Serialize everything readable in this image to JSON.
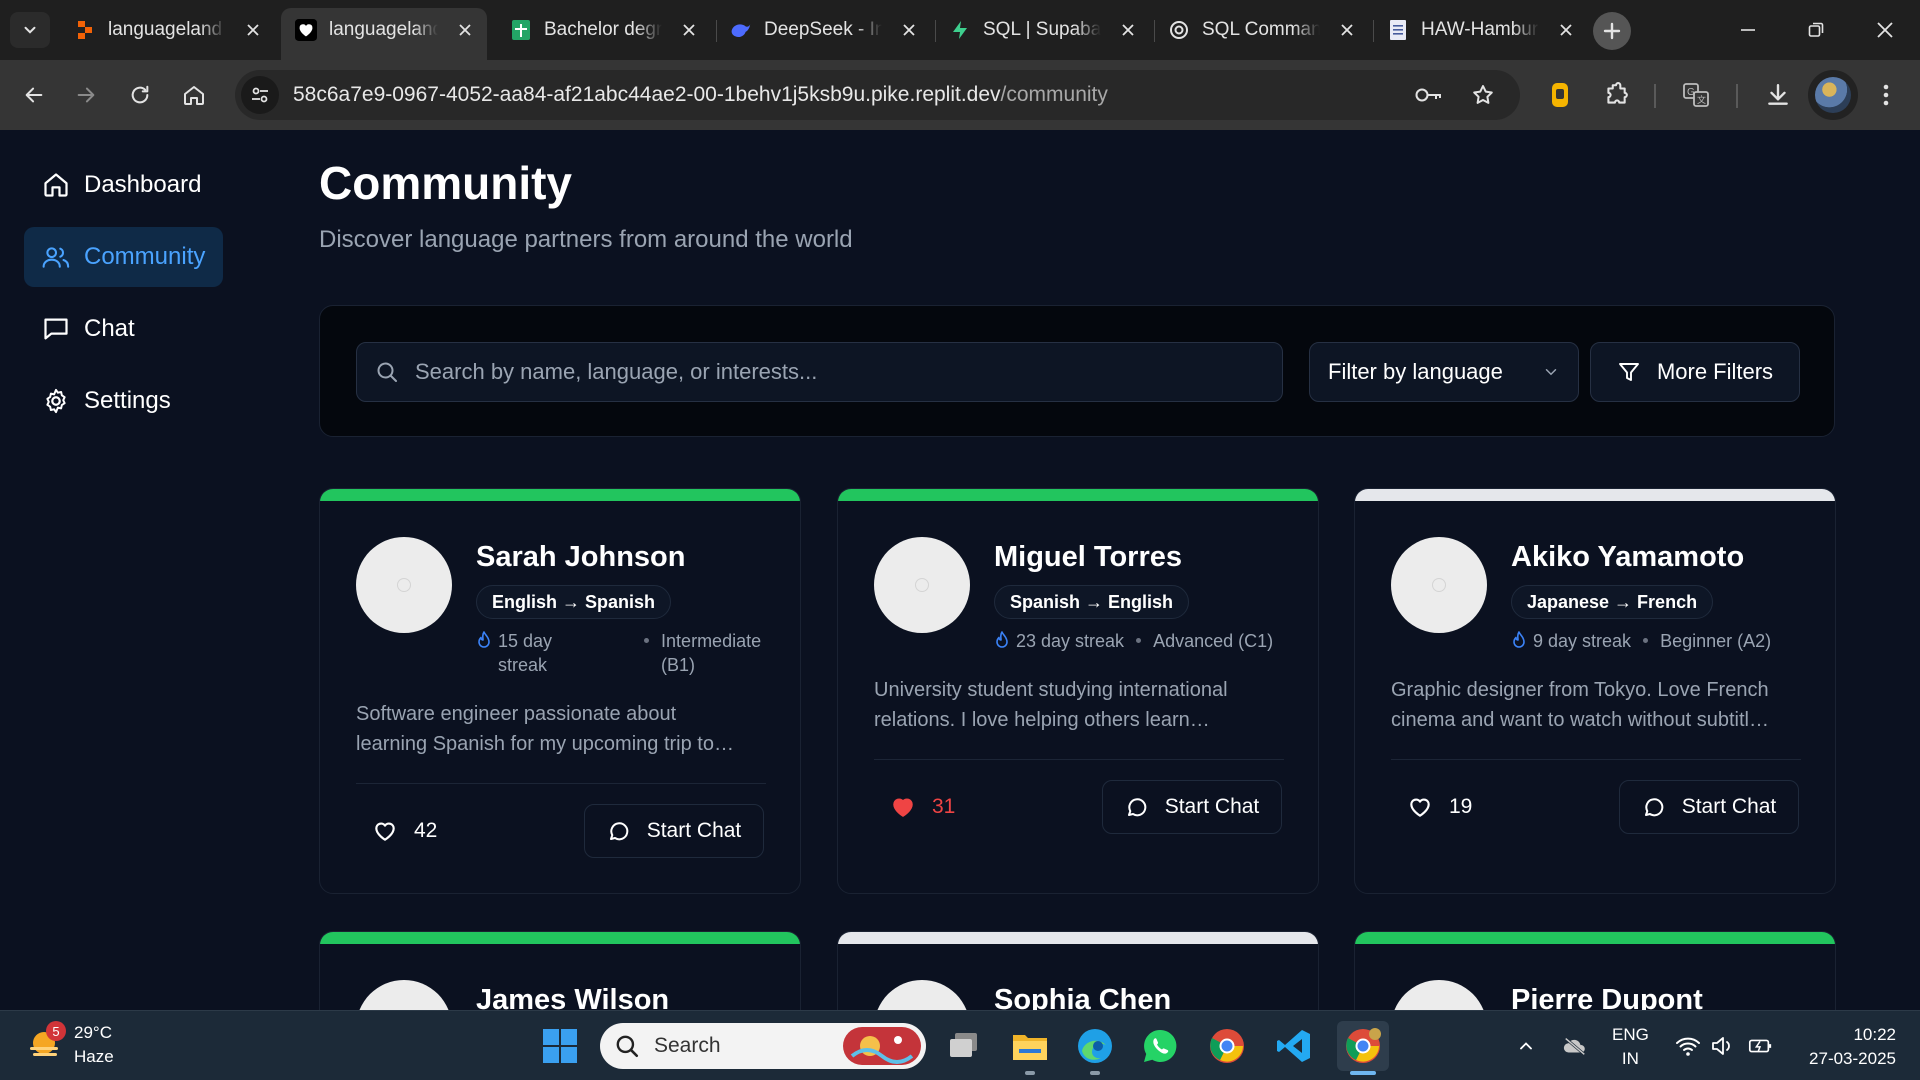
{
  "browser": {
    "tabs": [
      {
        "title": "languageland",
        "favicon": "replit-icon"
      },
      {
        "title": "languageland",
        "favicon": "heart-icon",
        "active": true
      },
      {
        "title": "Bachelor degr",
        "favicon": "sheets-icon"
      },
      {
        "title": "DeepSeek - In",
        "favicon": "deepseek-icon"
      },
      {
        "title": "SQL | Supabas",
        "favicon": "supabase-icon"
      },
      {
        "title": "SQL Comman",
        "favicon": "openai-icon"
      },
      {
        "title": "HAW-Hambur",
        "favicon": "docs-icon"
      }
    ],
    "url_host": "58c6a7e9-0967-4052-aa84-af21abc44ae2-00-1behv1j5ksb9u.pike.replit.dev",
    "url_path": "/community"
  },
  "sidebar": {
    "items": [
      {
        "label": "Dashboard",
        "icon": "home-icon"
      },
      {
        "label": "Community",
        "icon": "users-icon",
        "active": true
      },
      {
        "label": "Chat",
        "icon": "message-square-icon"
      },
      {
        "label": "Settings",
        "icon": "gear-icon"
      }
    ]
  },
  "page": {
    "title": "Community",
    "subtitle": "Discover language partners from around the world"
  },
  "filters": {
    "search_placeholder": "Search by name, language, or interests...",
    "language_select": "Filter by language",
    "more_filters": "More Filters"
  },
  "cards": [
    {
      "name": "Sarah Johnson",
      "pair": "English → Spanish",
      "streak_line1": "15 day",
      "streak_line2": "streak",
      "level_line1": "Intermediate",
      "level_line2": "(B1)",
      "bio_line1": "Software engineer passionate about",
      "bio_line2": "learning Spanish for my upcoming trip to…",
      "likes": "42",
      "liked": false,
      "chat_label": "Start Chat",
      "online": true
    },
    {
      "name": "Miguel Torres",
      "pair": "Spanish → English",
      "streak": "23 day streak",
      "level": "Advanced (C1)",
      "bio_line1": "University student studying international",
      "bio_line2": "relations. I love helping others learn…",
      "likes": "31",
      "liked": true,
      "chat_label": "Start Chat",
      "online": true
    },
    {
      "name": "Akiko Yamamoto",
      "pair": "Japanese → French",
      "streak": "9 day streak",
      "level": "Beginner (A2)",
      "bio_line1": "Graphic designer from Tokyo. Love French",
      "bio_line2": "cinema and want to watch without subtitl…",
      "likes": "19",
      "liked": false,
      "chat_label": "Start Chat",
      "online": false
    },
    {
      "name": "James Wilson",
      "online": true
    },
    {
      "name": "Sophia Chen",
      "online": false
    },
    {
      "name": "Pierre Dupont",
      "online": true
    }
  ],
  "colors": {
    "online_bar": "#22c55e",
    "offline_bar": "#e5e7eb",
    "accent": "#4aa3ff",
    "liked": "#ef4444"
  },
  "taskbar": {
    "weather_temp": "29°C",
    "weather_desc": "Haze",
    "weather_badge": "5",
    "search_label": "Search",
    "lang_line1": "ENG",
    "lang_line2": "IN",
    "time": "10:22",
    "date": "27-03-2025"
  }
}
